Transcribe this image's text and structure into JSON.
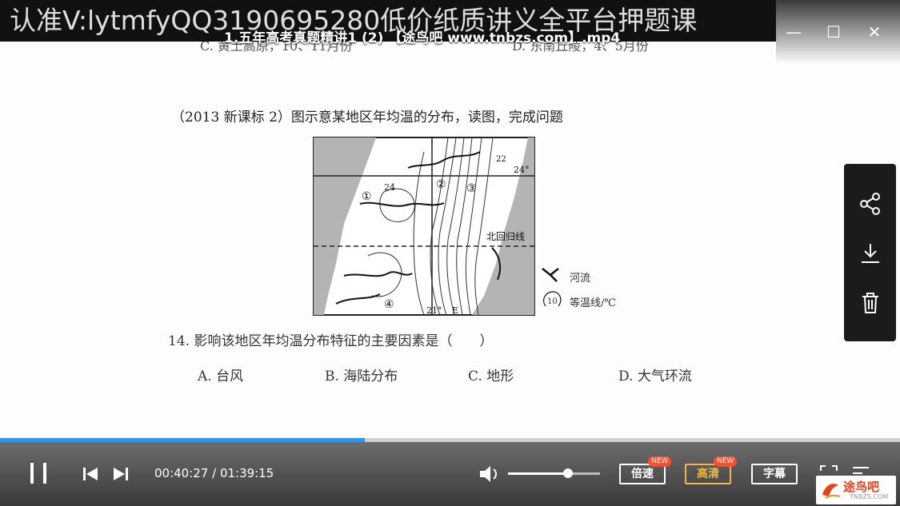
{
  "watermark": "认准V:lytmfyQQ3190695280低价纸质讲义全平台押题课",
  "window": {
    "title": "1.五年高考真题精讲1 (2) 【途鸟吧 www.tnbzs.com】.mp4",
    "minimize": "—",
    "maximize": "☐",
    "close": "✕"
  },
  "slide": {
    "cut_line_left": "C. 黄土高原，10、11月份",
    "cut_line_right": "D. 东南丘陵，4、5月份",
    "question_intro": "（2013 新课标 2）图示意某地区年均温的分布，读图，完成问题",
    "map_labels": {
      "circle1": "①",
      "circle2": "②",
      "circle3": "③",
      "circle4": "④",
      "iso24a": "24",
      "iso24b": "24°",
      "iso21": "21°",
      "iso22": "22",
      "letterE": "E",
      "tropic": "北回归线"
    },
    "legend_river": "河流",
    "legend_isotherm": "等温线/℃",
    "legend_isotherm_value": "10",
    "question14": "14. 影响该地区年均温分布特征的主要因素是（　　）",
    "options": [
      "A. 台风",
      "B. 海陆分布",
      "C. 地形",
      "D. 大气环流"
    ]
  },
  "side_panel": {
    "share": "share-icon",
    "download": "download-icon",
    "delete": "trash-icon"
  },
  "player": {
    "progress_fraction": 0.405,
    "current_time": "00:40:27",
    "total_time": "01:39:15",
    "time_display": "00:40:27 / 01:39:15",
    "volume_fraction": 0.65,
    "speed_label": "倍速",
    "quality_label": "高清",
    "subtitle_label": "字幕",
    "new_badge": "NEW",
    "accent": "#2b95ea",
    "quality_color": "#f0b64c"
  },
  "brand": {
    "name": "途鸟吧",
    "domain": "TNBZS.COM"
  }
}
